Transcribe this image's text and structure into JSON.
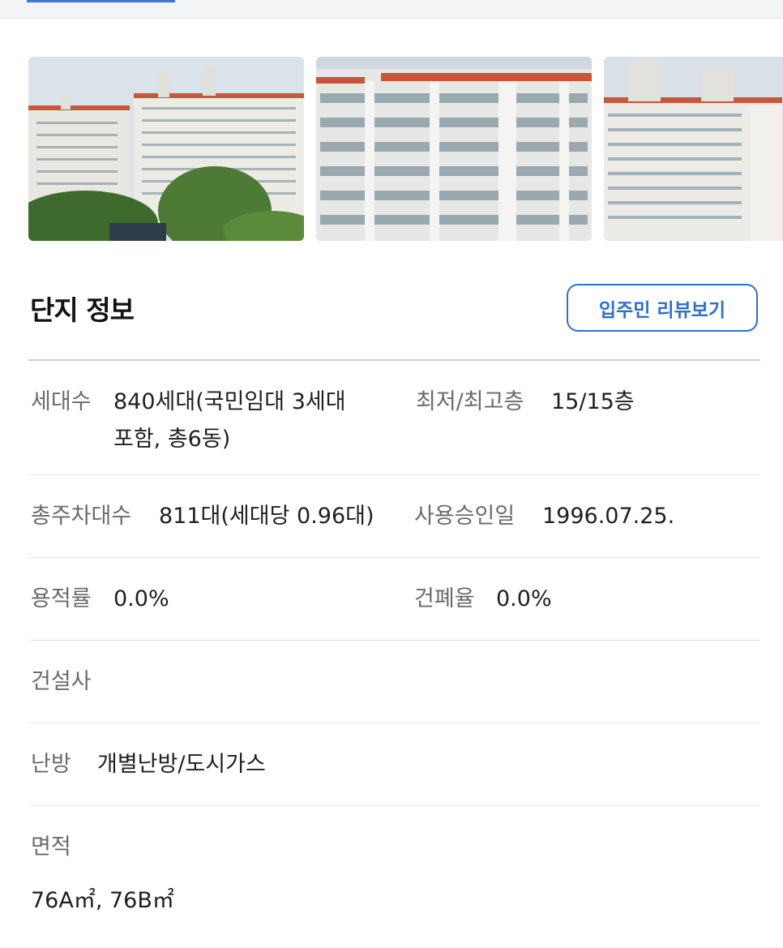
{
  "tabs": {
    "active_indicator_color": "#3b78d8"
  },
  "gallery": {
    "photos": [
      "apartment-photo",
      "apartment-photo",
      "apartment-photo"
    ]
  },
  "section": {
    "title": "단지 정보",
    "review_button": "입주민 리뷰보기"
  },
  "info": {
    "households_label": "세대수",
    "households_value_line1": "840세대(국민임대 3세대",
    "households_value_line2": "포함, 총6동)",
    "floors_label": "최저/최고층",
    "floors_value": "15/15층",
    "parking_label": "총주차대수",
    "parking_value": "811대(세대당 0.96대)",
    "approval_label": "사용승인일",
    "approval_value": "1996.07.25.",
    "far_label": "용적률",
    "far_value": "0.0%",
    "bcr_label": "건폐율",
    "bcr_value": "0.0%",
    "builder_label": "건설사",
    "heating_label": "난방",
    "heating_value": "개별난방/도시가스",
    "area_label": "면적",
    "area_value": "76A㎡, 76B㎡"
  },
  "colors": {
    "accent": "#2f6fd0",
    "label": "#6b6b6b",
    "divider": "#e5e5e5"
  }
}
